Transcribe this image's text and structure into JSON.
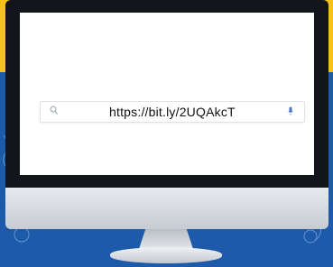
{
  "search": {
    "url_text": "https://bit.ly/2UQAkcT"
  },
  "icons": {
    "left": "search-icon",
    "right": "microphone-icon"
  },
  "colors": {
    "background_top": "#f4c21a",
    "background_bottom": "#1d5aa9",
    "bezel": "#121519",
    "screen": "#ffffff"
  }
}
